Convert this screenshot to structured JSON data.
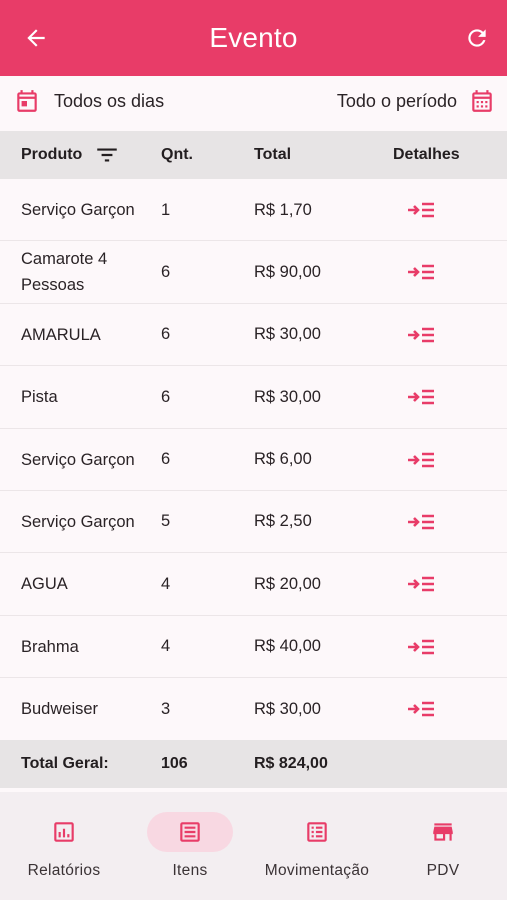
{
  "appbar": {
    "title": "Evento",
    "back_icon": "arrow-left-icon",
    "refresh_icon": "refresh-icon"
  },
  "filters": {
    "days": "Todos os dias",
    "period": "Todo o período"
  },
  "table": {
    "headers": {
      "product": "Produto",
      "qty": "Qnt.",
      "total": "Total",
      "details": "Detalhes"
    },
    "rows": [
      {
        "product": "Serviço Garçon",
        "qty": "1",
        "total": "R$ 1,70"
      },
      {
        "product": "Camarote 4 Pessoas",
        "qty": "6",
        "total": "R$ 90,00"
      },
      {
        "product": "AMARULA",
        "qty": "6",
        "total": "R$ 30,00"
      },
      {
        "product": "Pista",
        "qty": "6",
        "total": "R$ 30,00"
      },
      {
        "product": "Serviço Garçon",
        "qty": "6",
        "total": "R$ 6,00"
      },
      {
        "product": "Serviço Garçon",
        "qty": "5",
        "total": "R$ 2,50"
      },
      {
        "product": "AGUA",
        "qty": "4",
        "total": "R$ 20,00"
      },
      {
        "product": "Brahma",
        "qty": "4",
        "total": "R$ 40,00"
      },
      {
        "product": "Budweiser",
        "qty": "3",
        "total": "R$ 30,00"
      }
    ],
    "footer": {
      "label": "Total Geral:",
      "qty": "106",
      "total": "R$ 824,00"
    }
  },
  "nav": [
    {
      "label": "Relatórios",
      "icon": "report-icon",
      "active": false
    },
    {
      "label": "Itens",
      "icon": "list-icon",
      "active": true
    },
    {
      "label": "Movimentação",
      "icon": "movement-list-icon",
      "active": false
    },
    {
      "label": "PDV",
      "icon": "store-icon",
      "active": false
    }
  ],
  "colors": {
    "primary": "#e83c68",
    "active_pill": "#f8d8e2",
    "header_bg": "#e7e4e5"
  }
}
